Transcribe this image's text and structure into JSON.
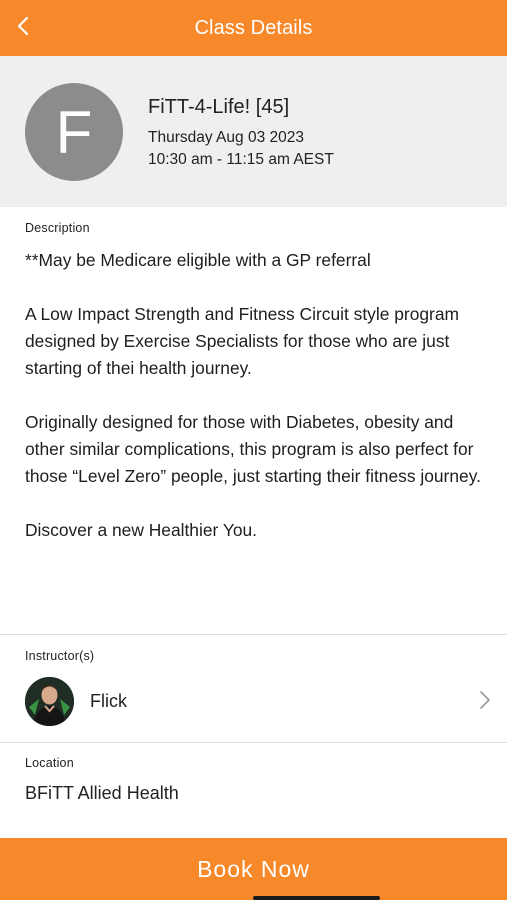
{
  "header": {
    "title": "Class Details"
  },
  "class_info": {
    "avatar_letter": "F",
    "name": "FiTT-4-Life! [45]",
    "date": "Thursday Aug 03 2023",
    "time": "10:30 am - 11:15 am AEST"
  },
  "description": {
    "label": "Description",
    "paragraphs": [
      "**May be Medicare eligible with a GP referral",
      "A Low Impact Strength and Fitness Circuit style program designed by Exercise Specialists for those who are just starting of thei health journey.",
      "Originally designed for those with Diabetes, obesity and other similar complications, this program is also perfect for those “Level Zero” people, just starting their fitness journey.",
      "Discover a new Healthier You."
    ]
  },
  "instructors": {
    "label": "Instructor(s)",
    "items": [
      {
        "name": "Flick"
      }
    ]
  },
  "location": {
    "label": "Location",
    "value": "BFiTT Allied Health"
  },
  "actions": {
    "book_label": "Book Now"
  },
  "colors": {
    "accent": "#f7892b",
    "summary_bg": "#efefef",
    "avatar_bg": "#8c8c8c"
  }
}
